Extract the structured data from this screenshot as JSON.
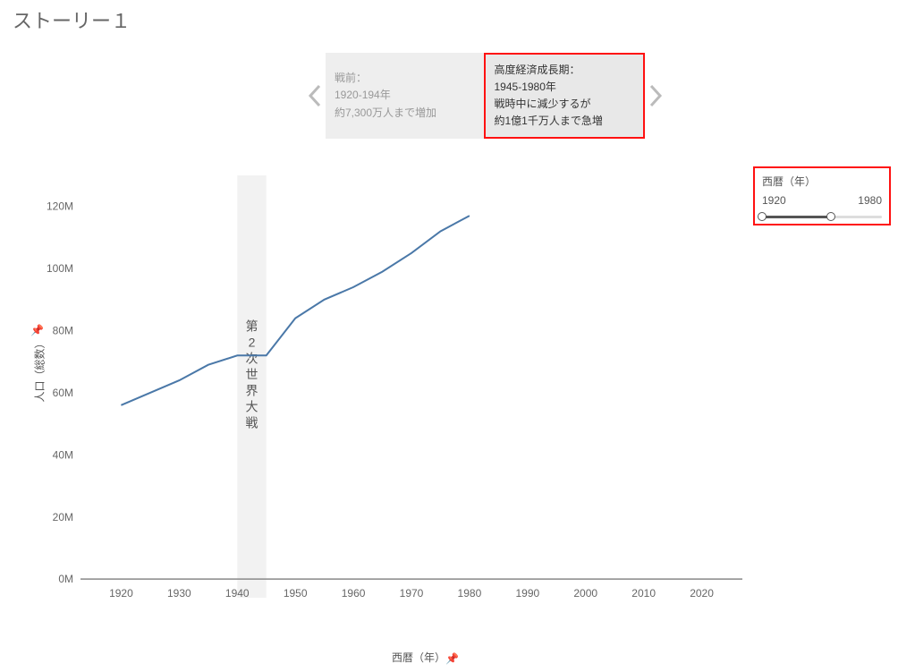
{
  "title": "ストーリー１",
  "story": {
    "prev_icon": "chevron-left",
    "next_icon": "chevron-right",
    "cards": [
      {
        "lines": [
          "戦前：",
          "1920-194年",
          "約7,300万人まで増加"
        ],
        "active": false
      },
      {
        "lines": [
          "高度経済成長期：",
          "1945-1980年",
          "戦時中に減少するが",
          "約1億1千万人まで急増"
        ],
        "active": true
      }
    ]
  },
  "filter": {
    "title": "西暦（年）",
    "min_label": "1920",
    "max_label": "1980",
    "full_min": 1920,
    "full_max": 2025,
    "sel_min": 1920,
    "sel_max": 1980
  },
  "chart": {
    "ylabel": "人口（総数）",
    "xlabel": "西暦（年）",
    "x_ticks": [
      1920,
      1930,
      1940,
      1950,
      1960,
      1970,
      1980,
      1990,
      2000,
      2010,
      2020
    ],
    "y_ticks": [
      0,
      20,
      40,
      60,
      80,
      100,
      120
    ],
    "y_tick_suffix": "M",
    "xlim": [
      1913,
      2027
    ],
    "ylim": [
      -6,
      130
    ],
    "annotation_band": {
      "x_start": 1940,
      "x_end": 1945,
      "label": "第2次世界大戦"
    }
  },
  "chart_data": {
    "type": "line",
    "title": "",
    "xlabel": "西暦（年）",
    "ylabel": "人口（総数）",
    "xlim": [
      1913,
      2027
    ],
    "ylim": [
      -6,
      130
    ],
    "series": [
      {
        "name": "人口（総数）",
        "x": [
          1920,
          1925,
          1930,
          1935,
          1940,
          1945,
          1950,
          1955,
          1960,
          1965,
          1970,
          1975,
          1980
        ],
        "y_millions": [
          56,
          60,
          64,
          69,
          72,
          72,
          84,
          90,
          94,
          99,
          105,
          112,
          117
        ]
      }
    ]
  }
}
